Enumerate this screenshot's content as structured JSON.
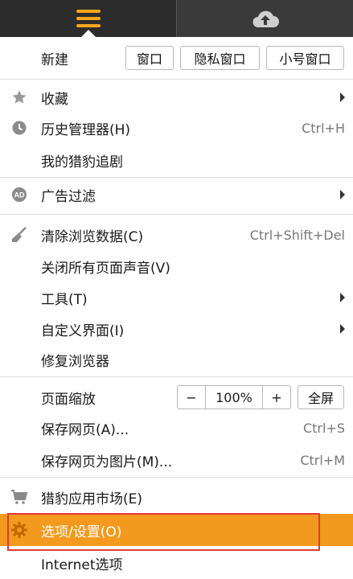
{
  "toolbar": {
    "menu_icon": "hamburger-icon",
    "cloud_icon": "cloud-upload-icon"
  },
  "new_row": {
    "label": "新建",
    "buttons": [
      "窗口",
      "隐私窗口",
      "小号窗口"
    ]
  },
  "items": {
    "favorites": {
      "label": "收藏",
      "icon": "star-icon"
    },
    "history": {
      "label": "历史管理器(H)",
      "shortcut": "Ctrl+H",
      "icon": "clock-icon"
    },
    "drama": {
      "label": "我的猎豹追剧"
    },
    "adblock": {
      "label": "广告过滤",
      "icon": "ad-block-icon"
    },
    "clear": {
      "label": "清除浏览数据(C)",
      "shortcut": "Ctrl+Shift+Del",
      "icon": "broom-icon"
    },
    "mute": {
      "label": "关闭所有页面声音(V)"
    },
    "tools": {
      "label": "工具(T)"
    },
    "customize": {
      "label": "自定义界面(I)"
    },
    "repair": {
      "label": "修复浏览器"
    },
    "zoom": {
      "label": "页面缩放",
      "minus": "−",
      "value": "100%",
      "plus": "+",
      "fullscreen": "全屏"
    },
    "save": {
      "label": "保存网页(A)...",
      "shortcut": "Ctrl+S"
    },
    "save_image": {
      "label": "保存网页为图片(M)...",
      "shortcut": "Ctrl+M"
    },
    "app_market": {
      "label": "猎豹应用市场(E)",
      "icon": "cart-icon"
    },
    "settings": {
      "label": "选项/设置(O)",
      "icon": "gear-icon"
    },
    "internet_options": {
      "label": "Internet选项"
    }
  },
  "colors": {
    "accent": "#f39a1e",
    "highlight_border": "#e53935",
    "topbar": "#2c2c2c"
  }
}
